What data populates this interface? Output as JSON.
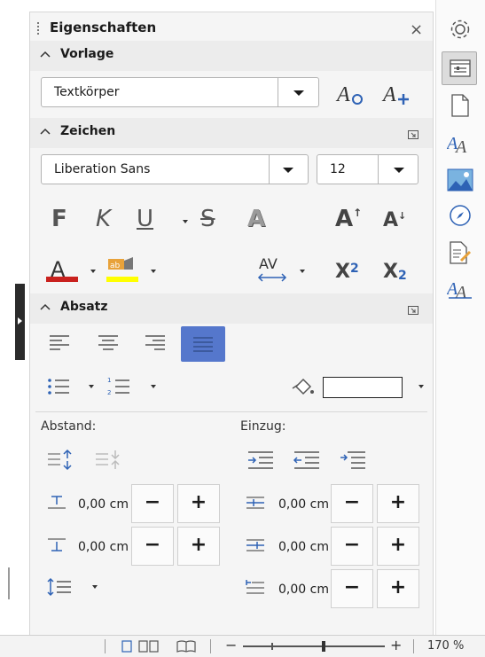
{
  "panel": {
    "title": "Eigenschaften",
    "close_glyph": "×"
  },
  "vorlage": {
    "heading": "Vorlage",
    "style_value": "Textkörper",
    "update_style_icon": "update-style-icon",
    "new_style_icon": "new-style-icon"
  },
  "zeichen": {
    "heading": "Zeichen",
    "font_name": "Liberation Sans",
    "font_size": "12",
    "bold": "F",
    "italic": "K",
    "underline": "U",
    "strike": "S",
    "shadow": "A",
    "grow": "A",
    "shrink": "A",
    "font_color_letter": "A",
    "font_color": "#c9211e",
    "highlight_color": "#ffff00",
    "spacing_label": "AV",
    "superscript": "X",
    "superscript_mark": "2",
    "subscript": "X",
    "subscript_mark": "2"
  },
  "absatz": {
    "heading": "Absatz",
    "active_align": "justify",
    "paragraph_bg_color": "#ffffff",
    "abstand_label": "Abstand:",
    "einzug_label": "Einzug:",
    "above_value": "0,00 cm",
    "below_value": "0,00 cm",
    "before_indent_value": "0,00 cm",
    "after_indent_value": "0,00 cm",
    "first_line_value": "0,00 cm",
    "minus": "−",
    "plus": "+"
  },
  "status": {
    "zoom_minus": "−",
    "zoom_plus": "+",
    "zoom_level": "170 %"
  },
  "colors": {
    "accent": "#4e7ad2",
    "active_fill": "#5577cc",
    "icon_blue": "#2e62b5"
  }
}
